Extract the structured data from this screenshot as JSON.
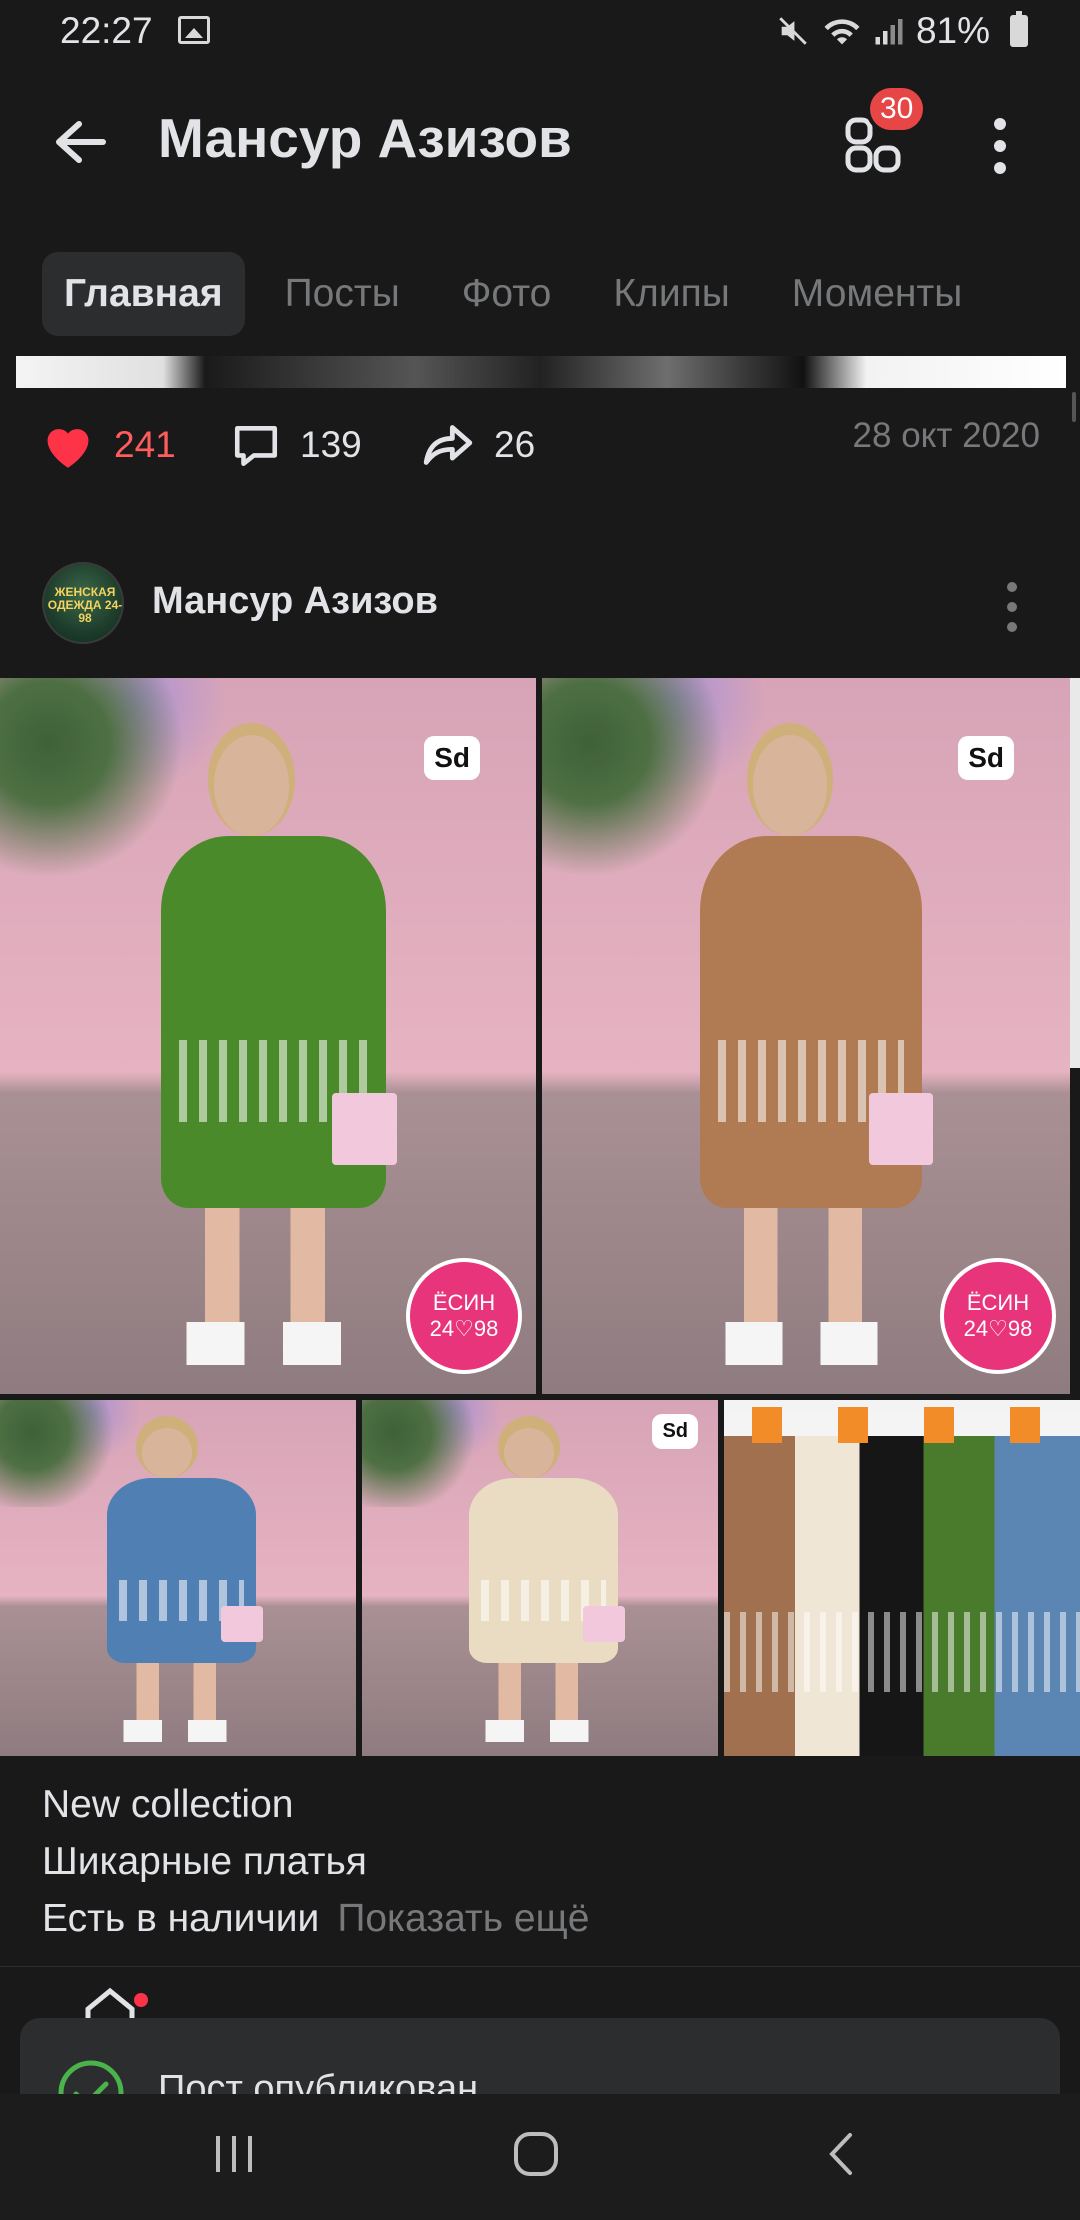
{
  "status_bar": {
    "time": "22:27",
    "battery": "81%",
    "icons": [
      "image-icon",
      "mute-icon",
      "wifi-icon",
      "signal-icon",
      "battery-icon"
    ]
  },
  "header": {
    "title": "Мансур Азизов",
    "badge_count": "30"
  },
  "tabs": [
    "Главная",
    "Посты",
    "Фото",
    "Клипы",
    "Моменты"
  ],
  "prev_post": {
    "likes": "241",
    "comments": "139",
    "shares": "26",
    "date": "28 окт 2020"
  },
  "post": {
    "author": "Мансур Азизов",
    "avatar_text": "ЖЕНСКАЯ ОДЕЖДА 24-98",
    "sd_label": "Sd",
    "logo_lines": [
      "ЁСИН",
      "24♡98"
    ],
    "caption_lines": [
      "New collection",
      "Шикарные платья",
      "Есть в наличии"
    ],
    "show_more": "Показать ещё"
  },
  "toast": {
    "text": "Пост опубликован"
  },
  "colors": {
    "background": "#19191a",
    "accent_red": "#ff5c5c",
    "badge_red": "#e64646",
    "muted_text": "#76787a"
  }
}
